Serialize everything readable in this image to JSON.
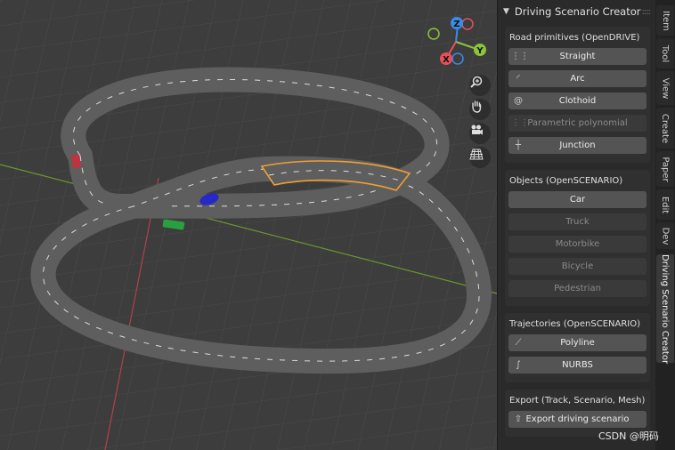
{
  "panel": {
    "title": "Driving Scenario Creator",
    "sections": {
      "road": {
        "title": "Road primitives (OpenDRIVE)",
        "buttons": [
          {
            "label": "Straight",
            "icon": "road-straight-icon",
            "enabled": true
          },
          {
            "label": "Arc",
            "icon": "road-arc-icon",
            "enabled": true
          },
          {
            "label": "Clothoid",
            "icon": "road-clothoid-icon",
            "enabled": true
          },
          {
            "label": "Parametric polynomial",
            "icon": "road-parampoly-icon",
            "enabled": false
          },
          {
            "label": "Junction",
            "icon": "road-junction-icon",
            "enabled": true
          }
        ]
      },
      "objects": {
        "title": "Objects (OpenSCENARIO)",
        "buttons": [
          {
            "label": "Car",
            "enabled": true
          },
          {
            "label": "Truck",
            "enabled": false
          },
          {
            "label": "Motorbike",
            "enabled": false
          },
          {
            "label": "Bicycle",
            "enabled": false
          },
          {
            "label": "Pedestrian",
            "enabled": false
          }
        ]
      },
      "trajectories": {
        "title": "Trajectories (OpenSCENARIO)",
        "buttons": [
          {
            "label": "Polyline",
            "icon": "polyline-icon",
            "enabled": true
          },
          {
            "label": "NURBS",
            "icon": "nurbs-icon",
            "enabled": true
          }
        ]
      },
      "export": {
        "title": "Export (Track, Scenario, Mesh)",
        "buttons": [
          {
            "label": "Export driving scenario",
            "icon": "export-icon",
            "enabled": true
          }
        ]
      }
    }
  },
  "tabs": [
    "Item",
    "Tool",
    "View",
    "Create",
    "Paper",
    "Edit",
    "Dev",
    "Driving Scenario Creator"
  ],
  "active_tab": "Driving Scenario Creator",
  "gizmo": {
    "z": "Z",
    "y": "Y",
    "x": "X"
  },
  "watermark": "CSDN @明码",
  "colors": {
    "axis_x": "#e8505b",
    "axis_y": "#8cc43a",
    "axis_z": "#3a8ce8",
    "selection": "#f0a030",
    "car_red": "#c0323c",
    "car_blue": "#2828c8",
    "car_green": "#28a040"
  }
}
